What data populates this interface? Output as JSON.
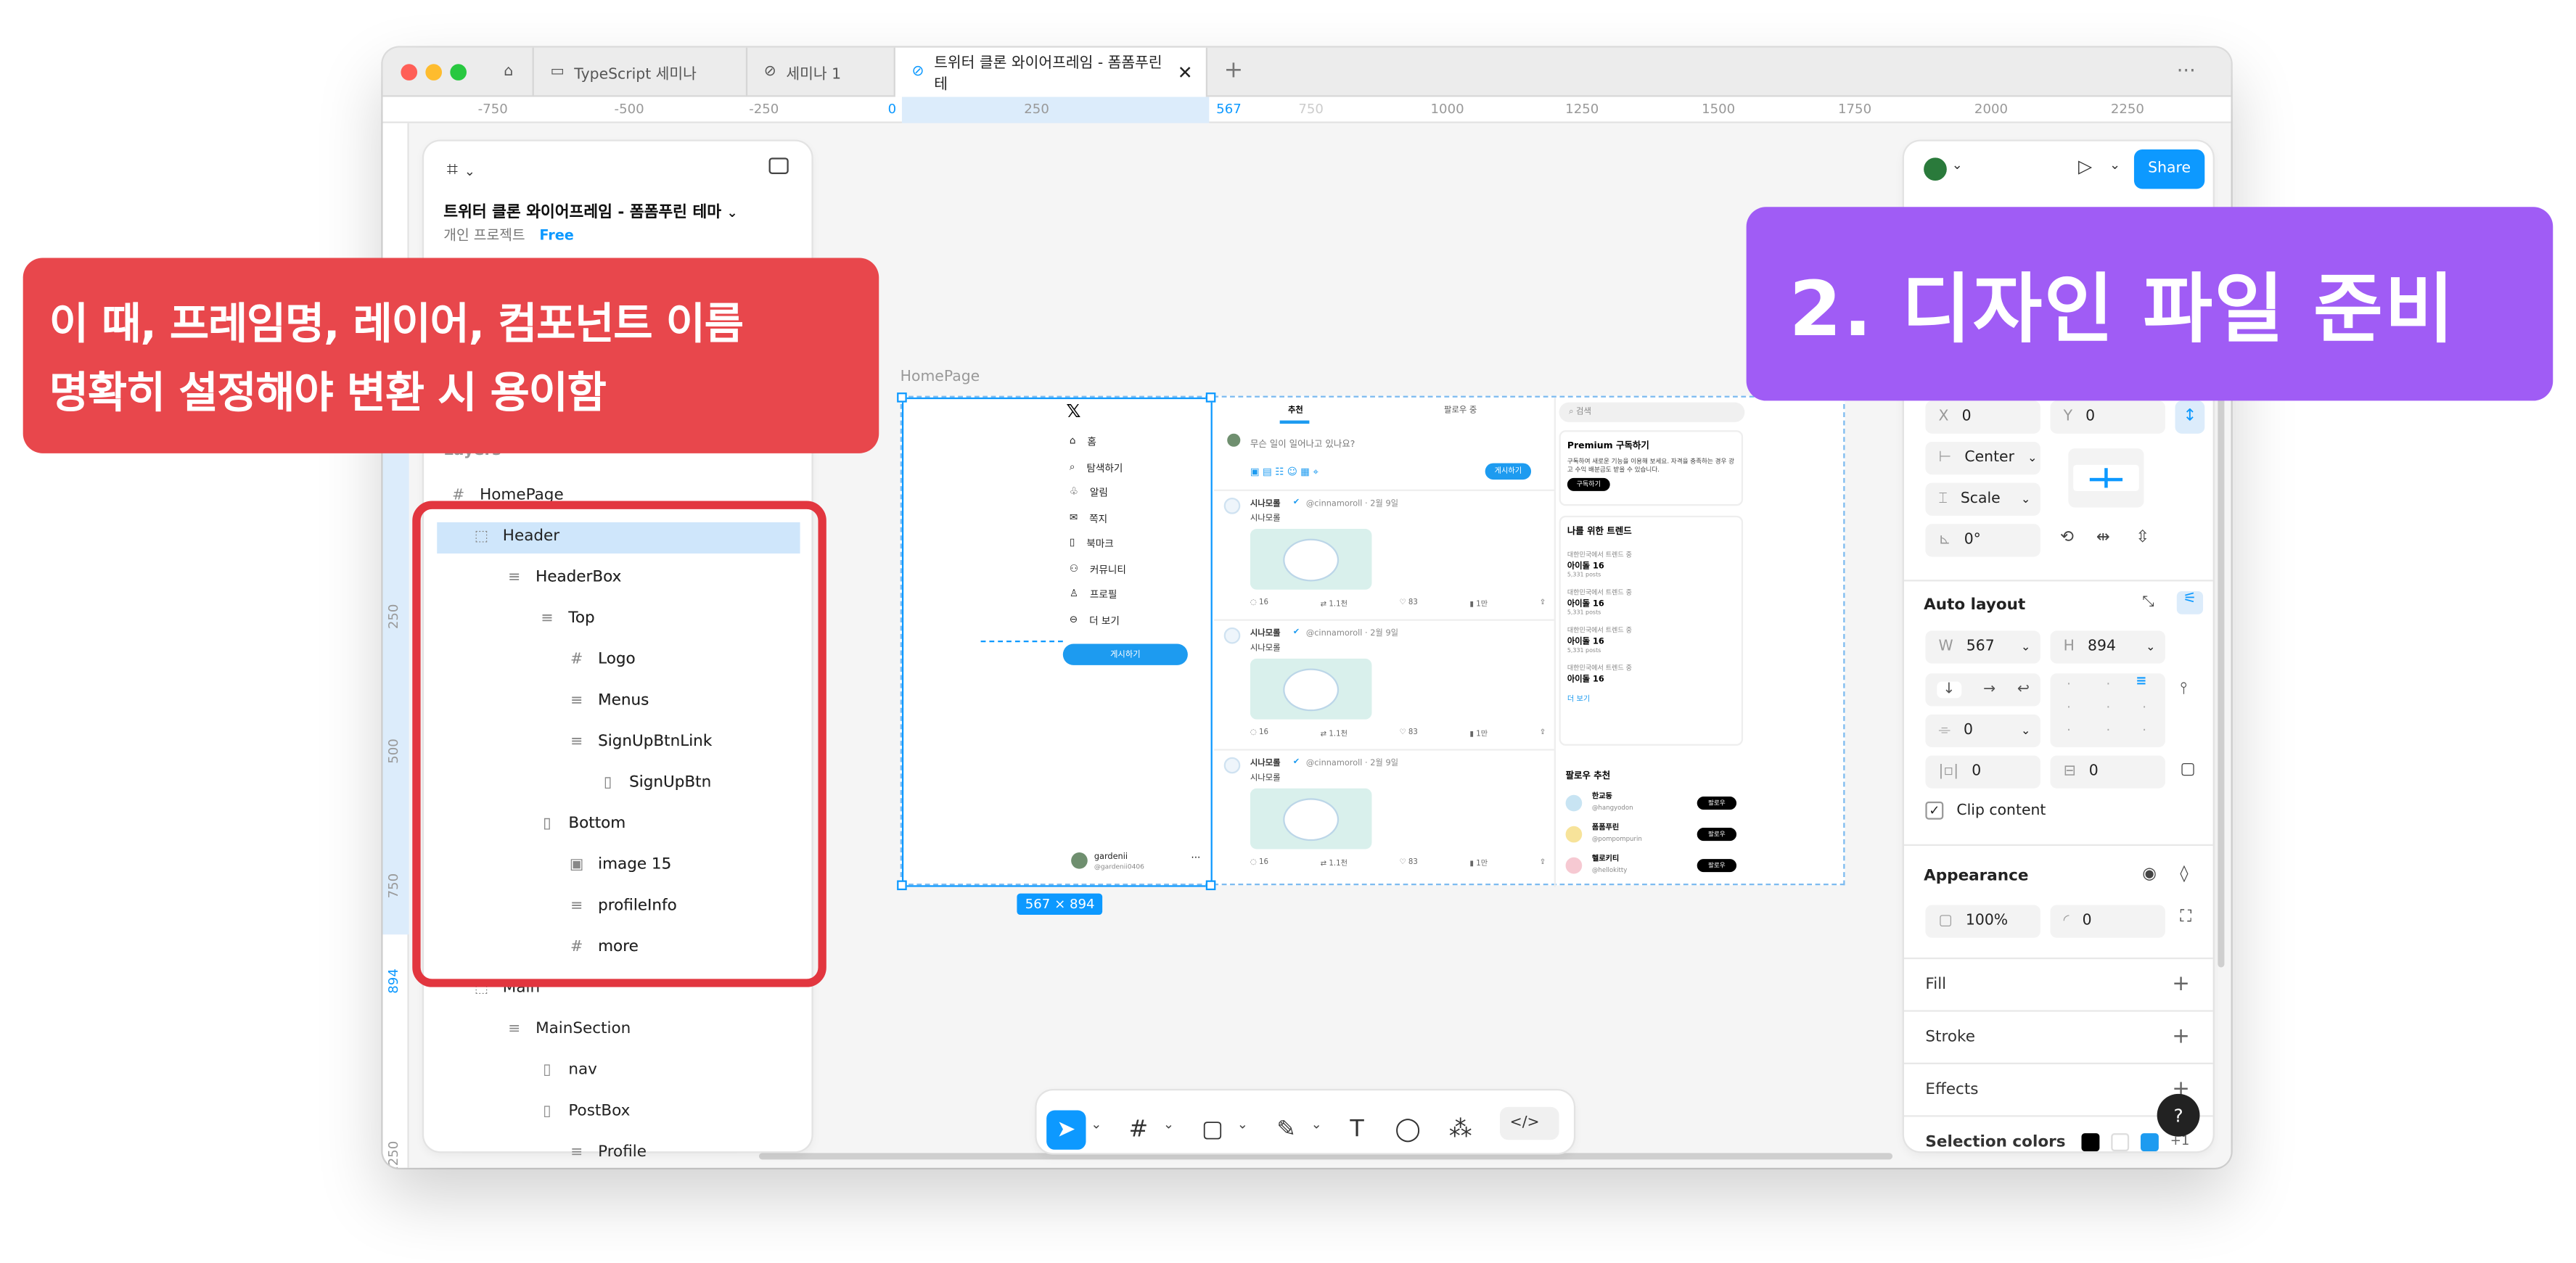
{
  "browser": {
    "tabs": [
      {
        "label": "TypeScript 세미나"
      },
      {
        "label": "세미나 1"
      },
      {
        "label": "트위터 클론 와이어프레임 - 폼폼푸린 테"
      }
    ],
    "new_tab": "+",
    "more": "···"
  },
  "ruler": {
    "h": [
      "-750",
      "-500",
      "-250",
      "0",
      "250",
      "567",
      "750",
      "1000",
      "1250",
      "1500",
      "1750",
      "2000",
      "2250"
    ],
    "v": [
      "250",
      "500",
      "750",
      "894",
      "1250",
      "250"
    ]
  },
  "left_panel": {
    "file_title": "트위터 클론 와이어프레임 - 폼폼푸린 테마",
    "project": "개인 프로젝트",
    "plan": "Free",
    "layers_heading": "Layers",
    "layers": [
      {
        "name": "HomePage",
        "icon": "#"
      },
      {
        "name": "Header",
        "icon": "⬚"
      },
      {
        "name": "HeaderBox",
        "icon": "≡"
      },
      {
        "name": "Top",
        "icon": "≡"
      },
      {
        "name": "Logo",
        "icon": "#"
      },
      {
        "name": "Menus",
        "icon": "≡"
      },
      {
        "name": "SignUpBtnLink",
        "icon": "≡"
      },
      {
        "name": "SignUpBtn",
        "icon": "▯"
      },
      {
        "name": "Bottom",
        "icon": "▯"
      },
      {
        "name": "image 15",
        "icon": "▣"
      },
      {
        "name": "profileInfo",
        "icon": "≡"
      },
      {
        "name": "more",
        "icon": "#"
      },
      {
        "name": "Main",
        "icon": "⬚"
      },
      {
        "name": "MainSection",
        "icon": "≡"
      },
      {
        "name": "nav",
        "icon": "▯"
      },
      {
        "name": "PostBox",
        "icon": "▯"
      },
      {
        "name": "Profile",
        "icon": "≡"
      }
    ]
  },
  "canvas": {
    "frame_label": "HomePage",
    "size_badge": "567 × 894",
    "mock": {
      "nav": [
        "홈",
        "탐색하기",
        "알림",
        "쪽지",
        "북마크",
        "커뮤니티",
        "프로필",
        "더 보기"
      ],
      "post_button": "게시하기",
      "profile_name": "gardenii",
      "profile_handle": "@gardenii0406",
      "tabs": [
        "추천",
        "팔로우 중"
      ],
      "compose_placeholder": "무슨 일이 일어나고 있나요?",
      "compose_button": "게시하기",
      "tweets": [
        {
          "name": "시나모롤",
          "handle": "@cinnamoroll · 2월 9일",
          "text": "시나모롤",
          "stats": [
            "16",
            "1.1천",
            "83",
            "1만"
          ]
        },
        {
          "name": "시나모롤",
          "handle": "@cinnamoroll · 2월 9일",
          "text": "시나모롤",
          "stats": [
            "16",
            "1.1천",
            "83",
            "1만"
          ]
        },
        {
          "name": "시나모롤",
          "handle": "@cinnamoroll · 2월 9일",
          "text": "시나모롤",
          "stats": [
            "16",
            "1.1천",
            "83",
            "1만"
          ]
        }
      ],
      "search_placeholder": "검색",
      "premium_title": "Premium 구독하기",
      "premium_text": "구독하여 새로운 기능을 이용해 보세요. 자격을 충족하는 경우 광고 수익 배분금도 받을 수 있습니다.",
      "premium_button": "구독하기",
      "trends_title": "나를 위한 트렌드",
      "trends": [
        {
          "cat": "대한민국에서 트렌드 중",
          "name": "아이돌 16",
          "posts": "5,331 posts"
        },
        {
          "cat": "대한민국에서 트렌드 중",
          "name": "아이돌 16",
          "posts": "5,331 posts"
        },
        {
          "cat": "대한민국에서 트렌드 중",
          "name": "아이돌 16",
          "posts": "5,331 posts"
        },
        {
          "cat": "대한민국에서 트렌드 중",
          "name": "아이돌 16",
          "posts": ""
        }
      ],
      "more_link": "더 보기",
      "follow_title": "팔로우 추천",
      "follow": [
        {
          "name": "한교동",
          "handle": "@hangyodon",
          "button": "팔로우"
        },
        {
          "name": "폼폼푸린",
          "handle": "@pompompurin",
          "button": "팔로우"
        },
        {
          "name": "헬로키티",
          "handle": "@hellokitty",
          "button": "팔로우"
        }
      ]
    }
  },
  "right_panel": {
    "share": "Share",
    "x_label": "X",
    "x_value": "0",
    "y_label": "Y",
    "y_value": "0",
    "h_constraint": "Center",
    "v_constraint": "Scale",
    "rotation": "0°",
    "auto_layout": "Auto layout",
    "w_label": "W",
    "w_value": "567",
    "h_label": "H",
    "h_value": "894",
    "gap_value": "0",
    "pad_h": "0",
    "pad_v": "0",
    "clip_content": "Clip content",
    "appearance": "Appearance",
    "opacity": "100%",
    "radius": "0",
    "fill": "Fill",
    "stroke": "Stroke",
    "effects": "Effects",
    "selection_colors": "Selection colors",
    "selection_more": "+1",
    "help": "?"
  },
  "callouts": {
    "left_line1": "이 때, 프레임명, 레이어, 컴포넌트 이름",
    "left_line2": "명확히 설정해야 변환 시 용이함",
    "right": "2. 디자인 파일 준비"
  },
  "colors": {
    "accent": "#0d99ff",
    "callout_red": "#e8474c",
    "callout_purple": "#a05cf5",
    "highlight_border": "#e2363f",
    "selection_fill": "#e6f1fb"
  }
}
